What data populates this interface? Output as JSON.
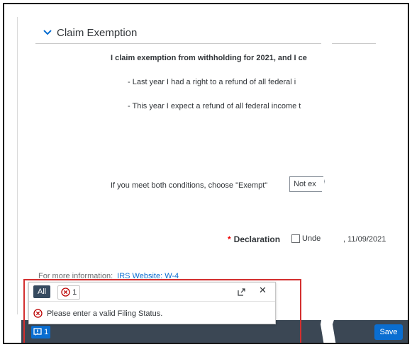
{
  "section": {
    "title": "Claim Exemption"
  },
  "claim": {
    "main_text": "I claim exemption from withholding for 2021, and I ce",
    "condition_1": "- Last year I had a right to a refund of all federal i",
    "condition_2": "- This year I expect a refund of all federal income t"
  },
  "exempt": {
    "label": "If you meet both conditions, choose \"Exempt\"",
    "value": "Not ex"
  },
  "declaration": {
    "required_mark": "*",
    "label": "Declaration",
    "checkbox_text": "Unde",
    "date": ", 11/09/2021"
  },
  "more_info": {
    "label": "For more information:",
    "link": "IRS Website: W-4"
  },
  "message_popover": {
    "tab_all": "All",
    "error_count": "1",
    "close_symbol": "✕",
    "error_message": "Please enter a valid Filing Status.",
    "icons": [
      "error-circle-icon",
      "expand-icon",
      "close-icon"
    ]
  },
  "footer": {
    "message_count": "1",
    "save_label": "Save"
  },
  "colors": {
    "accent": "#0a6ed1",
    "footer_bg": "#3b4754",
    "error": "#bb0000",
    "highlight_box": "#d32f2f"
  }
}
